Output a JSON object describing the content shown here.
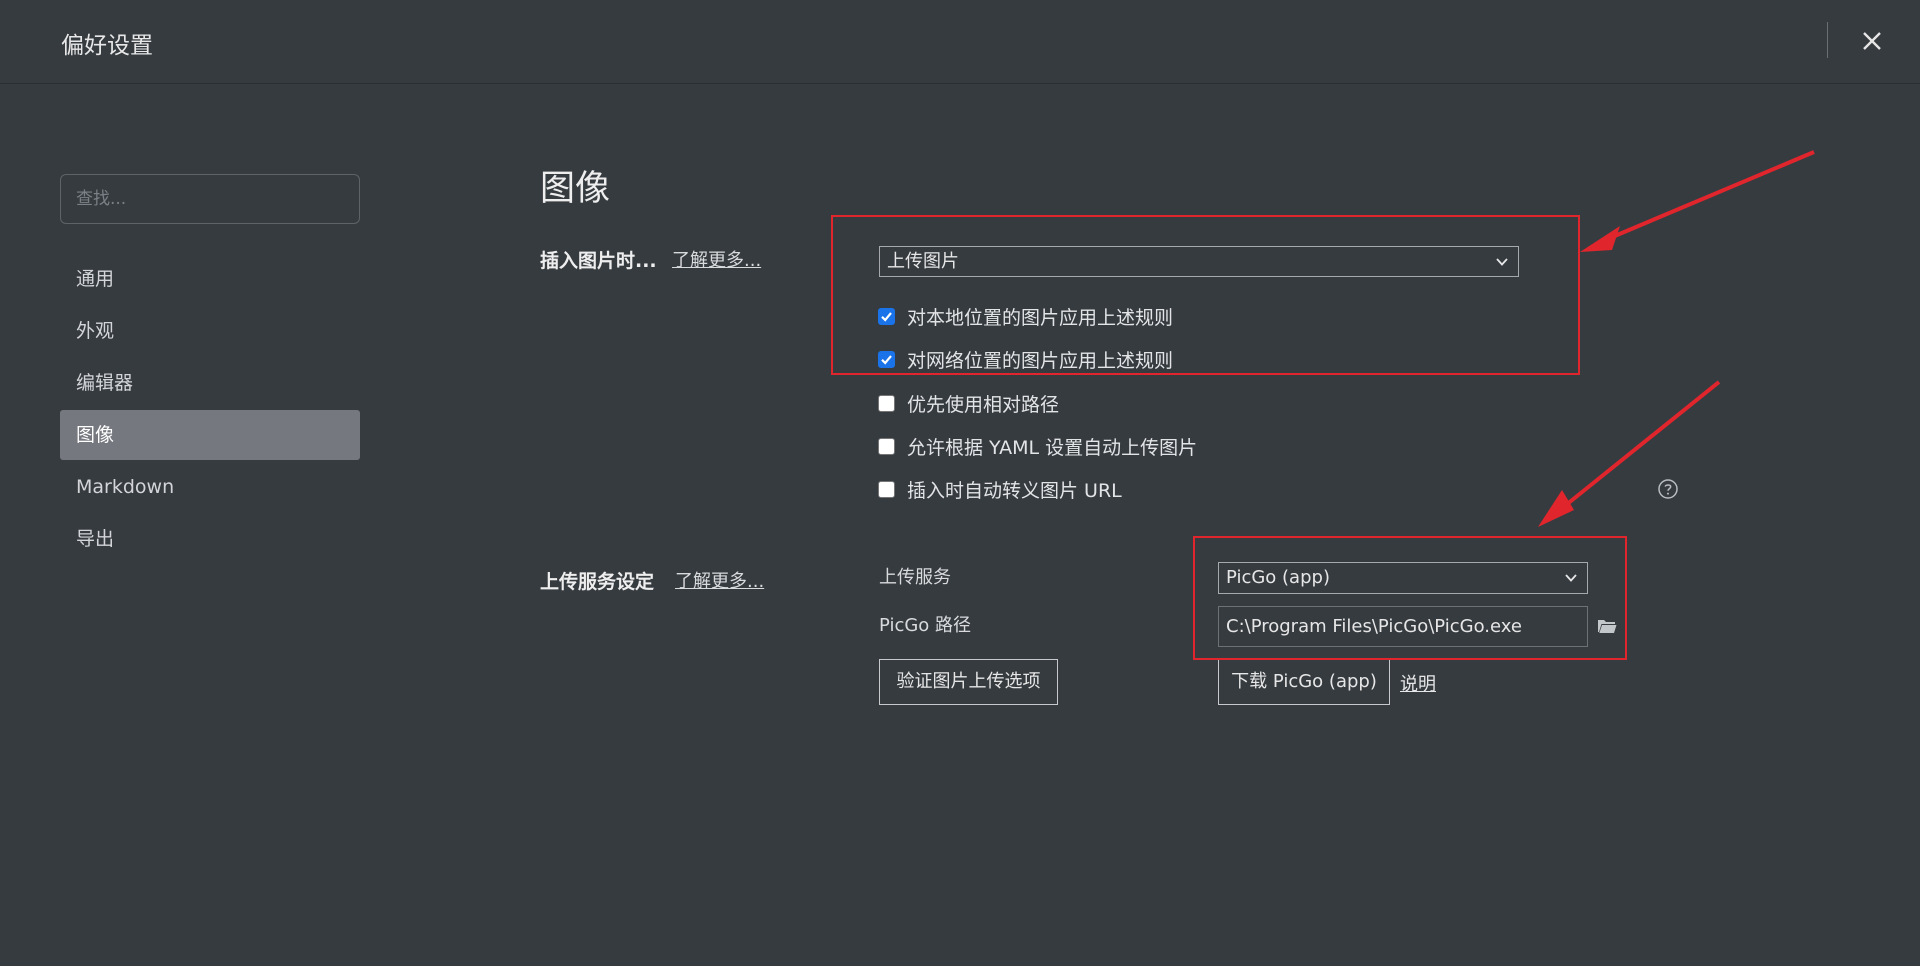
{
  "window": {
    "title": "偏好设置"
  },
  "sidebar": {
    "search_placeholder": "查找...",
    "items": [
      {
        "label": "通用"
      },
      {
        "label": "外观"
      },
      {
        "label": "编辑器"
      },
      {
        "label": "图像",
        "active": true
      },
      {
        "label": "Markdown"
      },
      {
        "label": "导出"
      }
    ]
  },
  "main": {
    "title": "图像",
    "insert_image": {
      "label": "插入图片时...",
      "learn_more": "了解更多...",
      "action_value": "上传图片",
      "options": [
        {
          "label": "对本地位置的图片应用上述规则",
          "checked": true
        },
        {
          "label": "对网络位置的图片应用上述规则",
          "checked": true
        },
        {
          "label": "优先使用相对路径",
          "checked": false
        },
        {
          "label": "允许根据 YAML 设置自动上传图片",
          "checked": false
        },
        {
          "label": "插入时自动转义图片 URL",
          "checked": false
        }
      ]
    },
    "upload_service": {
      "label": "上传服务设定",
      "learn_more": "了解更多...",
      "service_label": "上传服务",
      "service_value": "PicGo (app)",
      "path_label": "PicGo 路径",
      "path_value": "C:\\Program Files\\PicGo\\PicGo.exe",
      "verify_button": "验证图片上传选项",
      "download_button": "下载 PicGo (app)",
      "doc_link": "说明"
    }
  },
  "icons": {
    "close": "close-icon",
    "chevron": "chevron-down-icon",
    "help": "help-circle-icon",
    "folder": "folder-icon",
    "check": "check-icon"
  },
  "colors": {
    "background": "#363b40",
    "active_item": "#76787f",
    "checkbox_on": "#1a73e8",
    "annotation": "#e0262c"
  }
}
